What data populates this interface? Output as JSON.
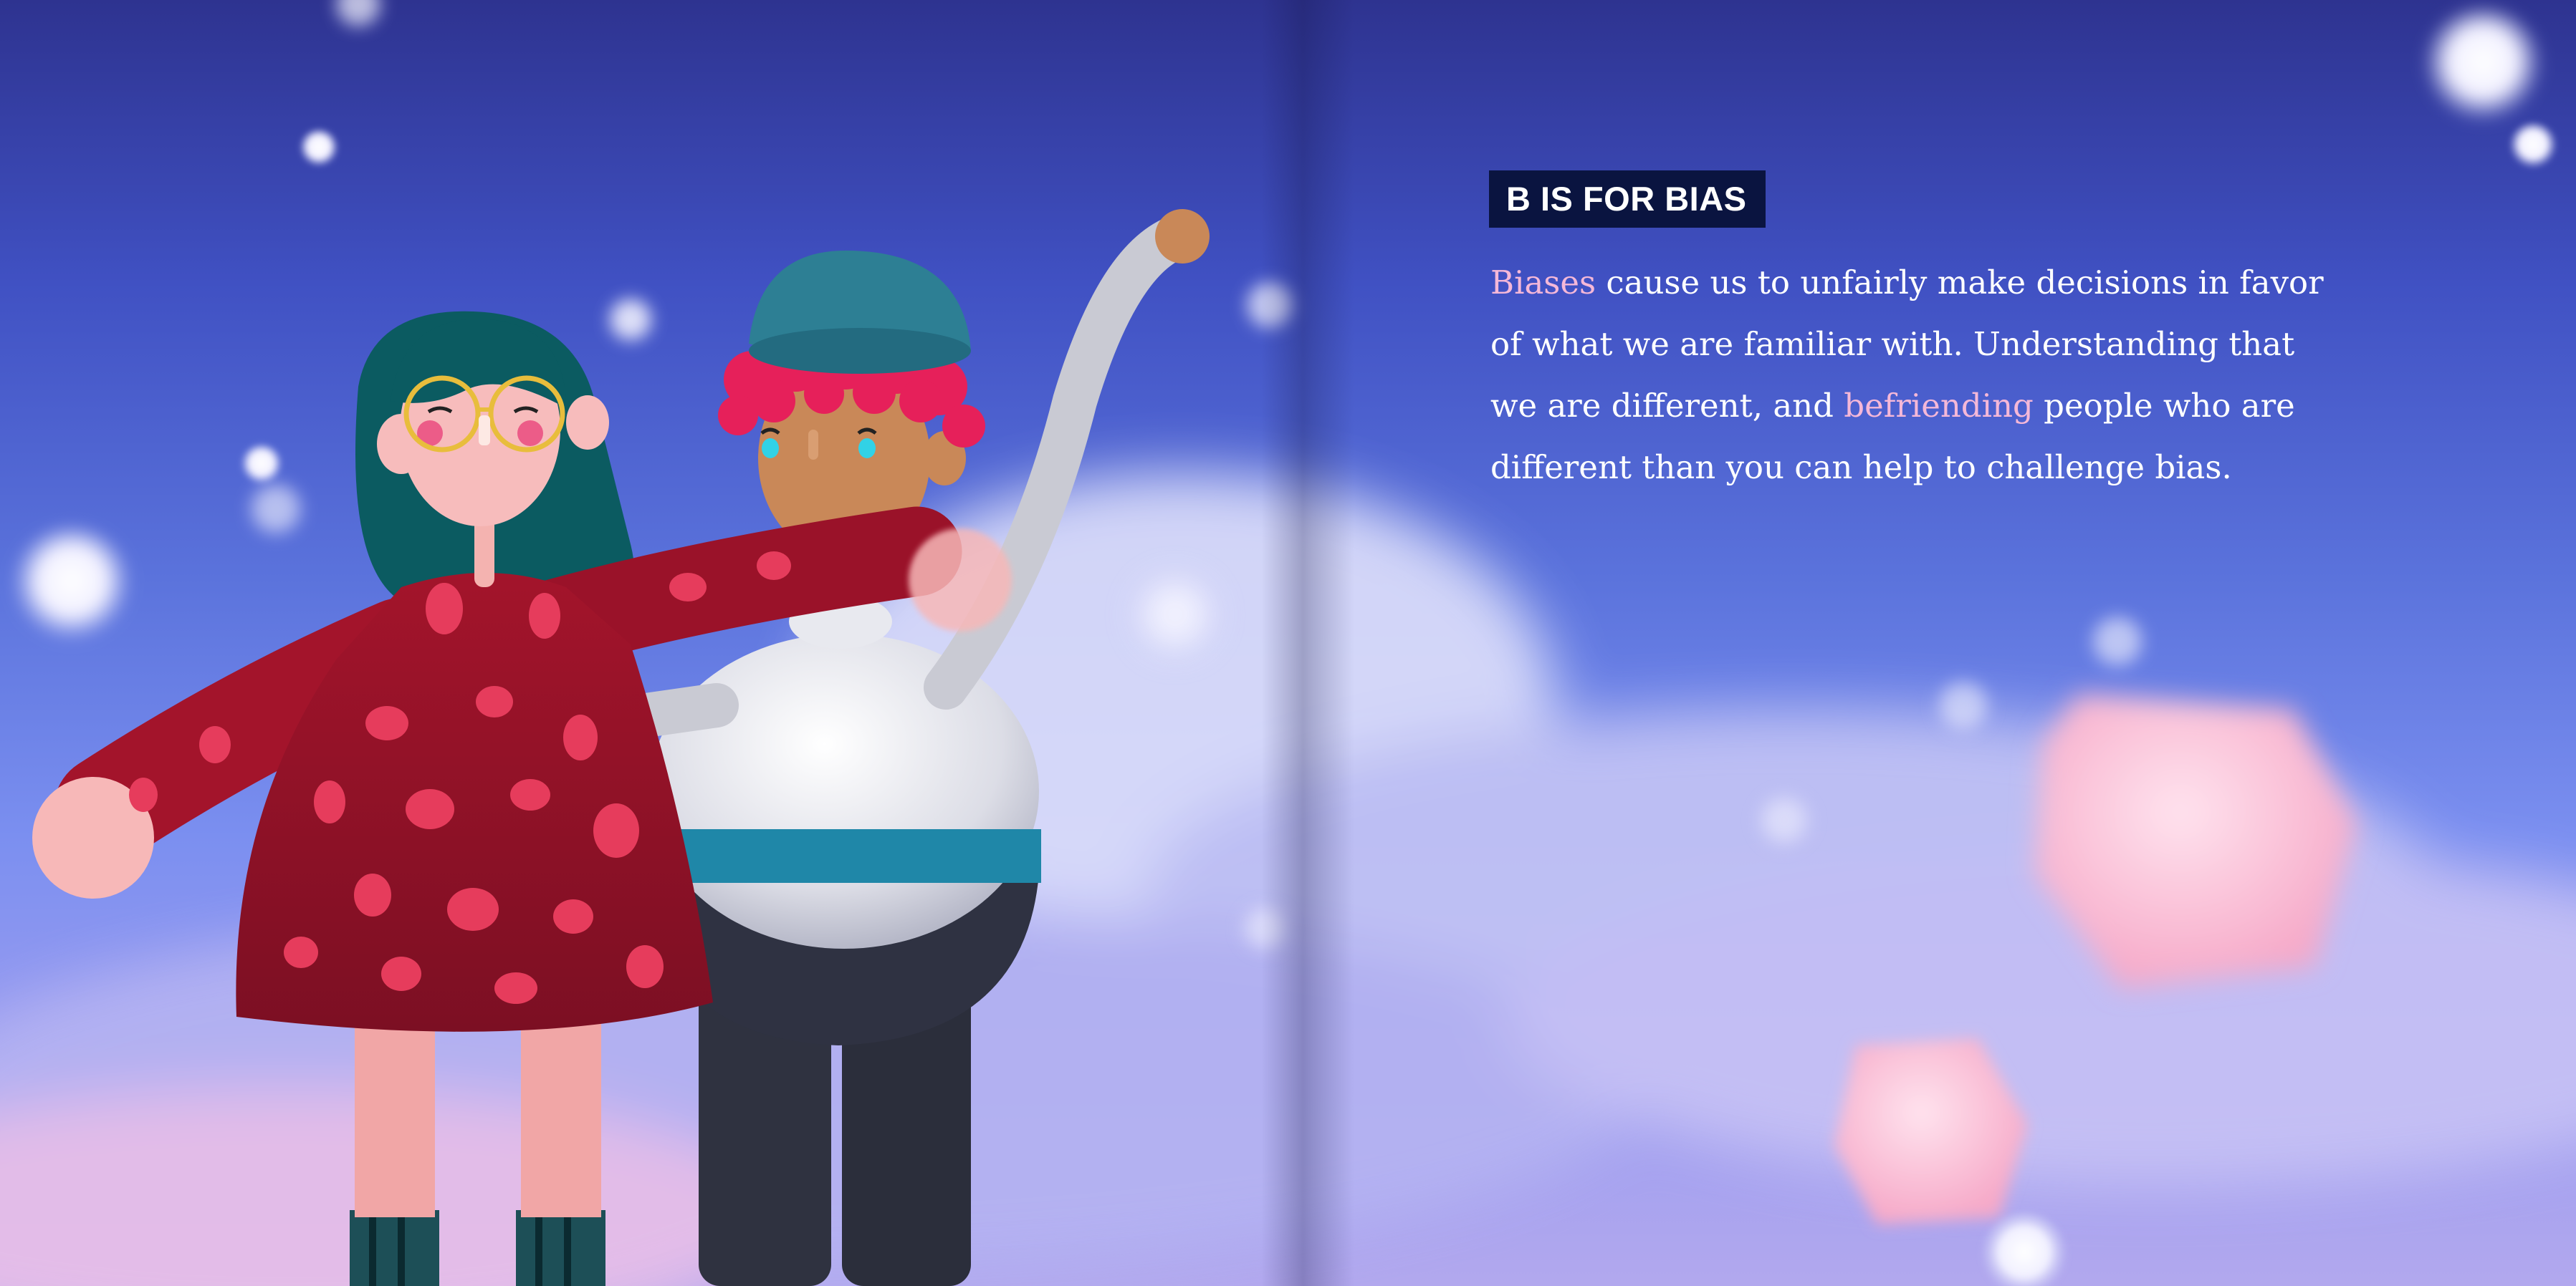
{
  "page": {
    "heading": "B IS FOR BIAS",
    "body_lines": [
      {
        "highlight": "Biases",
        "text": " cause us to unfairly make decisions in favor"
      },
      {
        "text": "of what we are familiar with. Understanding that"
      },
      {
        "text": "we are different, and ",
        "highlight": "befriending",
        "after": " people who are"
      },
      {
        "text": "different than you can help to challenge bias."
      }
    ]
  },
  "colors": {
    "highlight": "#f5b8d8",
    "title_badge": "#0a1440",
    "sky_top": "#2e3390",
    "sky_bottom": "#b2a8ee"
  },
  "illustration": {
    "characters": [
      "girl-with-glasses-and-red-spotted-dress",
      "boy-with-blue-beanie-and-raised-arm"
    ],
    "decor": [
      "snow-orbs",
      "pink-cubes",
      "soft-clouds"
    ]
  }
}
